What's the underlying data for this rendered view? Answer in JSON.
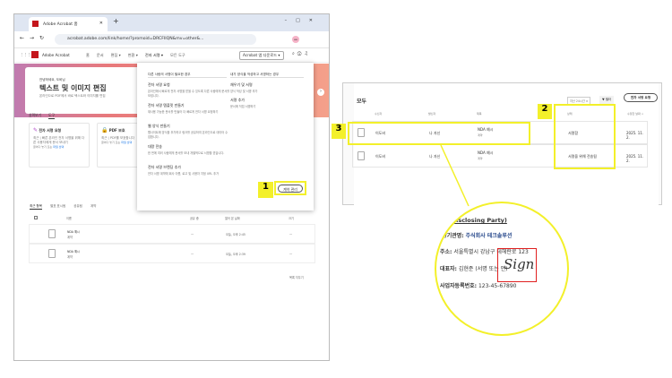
{
  "browser": {
    "tab_title": "Adobe Acrobat 홈",
    "url": "acrobat.adobe.com/link/home/?promoid=DRCFIIQN&mv=other&...",
    "profile": "ee"
  },
  "app": {
    "name": "Adobe Acrobat",
    "nav": [
      "홈",
      "문서",
      "편집 ▾",
      "변환 ▾",
      "전자 서명 ▾",
      "모든 도구"
    ],
    "download": "Acrobat 앱 다운로드 ▾"
  },
  "hero": {
    "greeting": "안녕하세요, 도비님",
    "title": "텍스트 및 이미지 편집",
    "subtitle": "온라인으로 PDF에서 바로 텍스트와 이미지를 편집"
  },
  "menu": {
    "left_heading": "다른 사람의 서명이 필요한 경우",
    "right_heading": "내가 양식을 작성하고 서명하는 경우",
    "left_items": [
      {
        "title": "전자 서명 요청",
        "desc": "온라인에서 빠르게 전자 서명을 받을 수 있도록 다른 사람에게 문서를 보냅니다."
      },
      {
        "title": "전자 서명 템플릿 만들기",
        "desc": "재사용 가능한 문서를 만들어 더 빠르게 전자 서명 요청하기"
      },
      {
        "title": "웹 양식 만들기",
        "desc": "웹사이트에 양식을 추가하고 링크를 공유하여 온라인으로 데이터 수집합니다."
      },
      {
        "title": "대량 전송",
        "desc": "한 번에 여러 사람에게 문서를 보내 개별적으로 서명을 받습니다."
      },
      {
        "title": "전자 서명 브랜딩 추가",
        "desc": "전자 서명 계약에 회사 이름, 로고 및 사용자 지정 URL 추가"
      }
    ],
    "right_items": [
      {
        "title": "채우기 및 서명",
        "desc": "양식 작성 및 서명 추가"
      },
      {
        "title": "서명 추가",
        "desc": "문서에 직접 서명하기"
      }
    ],
    "manage_button": "계약 관리"
  },
  "tools": {
    "tabs": [
      "살펴보기",
      "도구"
    ],
    "cards": [
      {
        "title": "전자 서명 요청",
        "desc": "최근 | 빠른 온라인 전자 서명을 위해 다른 사용자에게 문서 보내기",
        "link_prefix": "끌어다 놓기 또는",
        "link": "파일 선택"
      },
      {
        "title": "PDF 보호",
        "desc": "최근 | PDF를 보호합니다",
        "link_prefix": "끌어다 놓기 또는",
        "link": "파일 선택"
      }
    ]
  },
  "recent": {
    "tabs": [
      "최근 항목",
      "별표 표시됨",
      "공유됨",
      "계약"
    ],
    "columns": [
      "이름",
      "공유 중",
      "열어 본 날짜",
      "크기"
    ],
    "rows": [
      {
        "name": "NDA 예시",
        "type": "계약",
        "shared": "—",
        "opened": "오늘, 오후 2:45",
        "size": "—"
      },
      {
        "name": "NDA 예시",
        "type": "계약",
        "shared": "—",
        "opened": "오늘, 오후 2:39",
        "size": "—"
      }
    ],
    "clear": "목록 지우기"
  },
  "agreements": {
    "title": "모두",
    "filter_chip": "지난 24시간 ×",
    "filter": "필터",
    "request": "전자 서명 요청",
    "columns": [
      "수신자",
      "발신자",
      "제목",
      "상태",
      "수정한 날짜 ↓"
    ],
    "rows": [
      {
        "recipient": "이도비",
        "sender": "나 자신",
        "title": "NDA 예시",
        "type": "계약",
        "status": "서명함",
        "date": "2025. 11. 2."
      },
      {
        "recipient": "이도비",
        "sender": "나 자신",
        "title": "NDA 예시",
        "type": "계약",
        "status": "서명을 위해 전송됨",
        "date": "2025. 11. 2."
      }
    ]
  },
  "doc": {
    "heading": "사, Disclosing Party)",
    "company_label": "사/기관명:",
    "company": "주식회사 테크솔루션",
    "addr_label": "주소:",
    "addr": "서울특별시 강남구 테헤란로 123",
    "rep_label": "대표자:",
    "rep": "김현준 (서명 또는 인)",
    "reg_label": "사업자등록번호:",
    "reg": "123-45-67890",
    "signature": "Sign"
  },
  "callouts": [
    "1",
    "2",
    "3"
  ],
  "colors": {
    "highlight": "#f3f02a",
    "acrobat_red": "#c4161c",
    "link": "#1473e6"
  }
}
